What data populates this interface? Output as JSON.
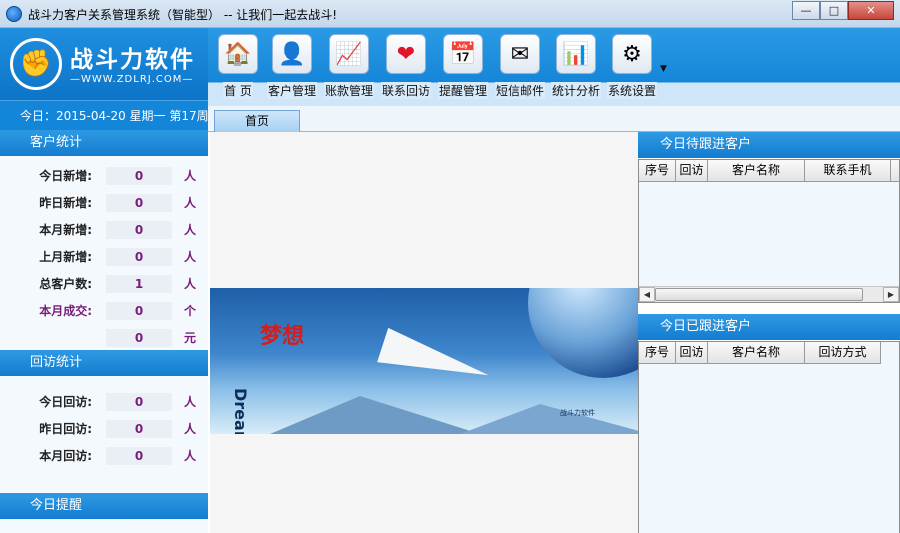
{
  "window": {
    "title": "战斗力客户关系管理系统（智能型） -- 让我们一起去战斗!",
    "buttons": {
      "minimize": "—",
      "maximize": "□",
      "close": "✕"
    }
  },
  "logo": {
    "name": "战斗力软件",
    "url": "—WWW.ZDLRJ.COM—"
  },
  "date_line": "今日：2015-04-20 星期一 第17周",
  "customer_stats": {
    "title": "客户统计",
    "rows": [
      {
        "label": "今日新增:",
        "value": "0",
        "unit": "人"
      },
      {
        "label": "昨日新增:",
        "value": "0",
        "unit": "人"
      },
      {
        "label": "本月新增:",
        "value": "0",
        "unit": "人"
      },
      {
        "label": "上月新增:",
        "value": "0",
        "unit": "人"
      },
      {
        "label": "总客户数:",
        "value": "1",
        "unit": "人"
      },
      {
        "label": "本月成交:",
        "value": "0",
        "unit": "个"
      },
      {
        "label": "",
        "value": "0",
        "unit": "元"
      }
    ]
  },
  "visit_stats": {
    "title": "回访统计",
    "rows": [
      {
        "label": "今日回访:",
        "value": "0",
        "unit": "人"
      },
      {
        "label": "昨日回访:",
        "value": "0",
        "unit": "人"
      },
      {
        "label": "本月回访:",
        "value": "0",
        "unit": "人"
      }
    ]
  },
  "reminder_section": {
    "title": "今日提醒"
  },
  "toolbar": {
    "items": [
      {
        "label": "首 页",
        "icon": "home-icon"
      },
      {
        "label": "客户管理",
        "icon": "customer-icon"
      },
      {
        "label": "账款管理",
        "icon": "account-chart-icon"
      },
      {
        "label": "联系回访",
        "icon": "heart-icon"
      },
      {
        "label": "提醒管理",
        "icon": "calendar-icon"
      },
      {
        "label": "短信邮件",
        "icon": "mail-icon"
      },
      {
        "label": "统计分析",
        "icon": "analytics-icon"
      },
      {
        "label": "系统设置",
        "icon": "gear-icon"
      }
    ]
  },
  "tabs": [
    {
      "label": "首页"
    }
  ],
  "banner": {
    "dream_cn": "梦想",
    "dream_en": "Dream",
    "brand": "战斗力软件"
  },
  "pending_panel": {
    "title": "今日待跟进客户",
    "columns": [
      "序号",
      "回访",
      "客户名称",
      "联系手机"
    ]
  },
  "done_panel": {
    "title": "今日已跟进客户",
    "columns": [
      "序号",
      "回访",
      "客户名称",
      "回访方式"
    ]
  }
}
